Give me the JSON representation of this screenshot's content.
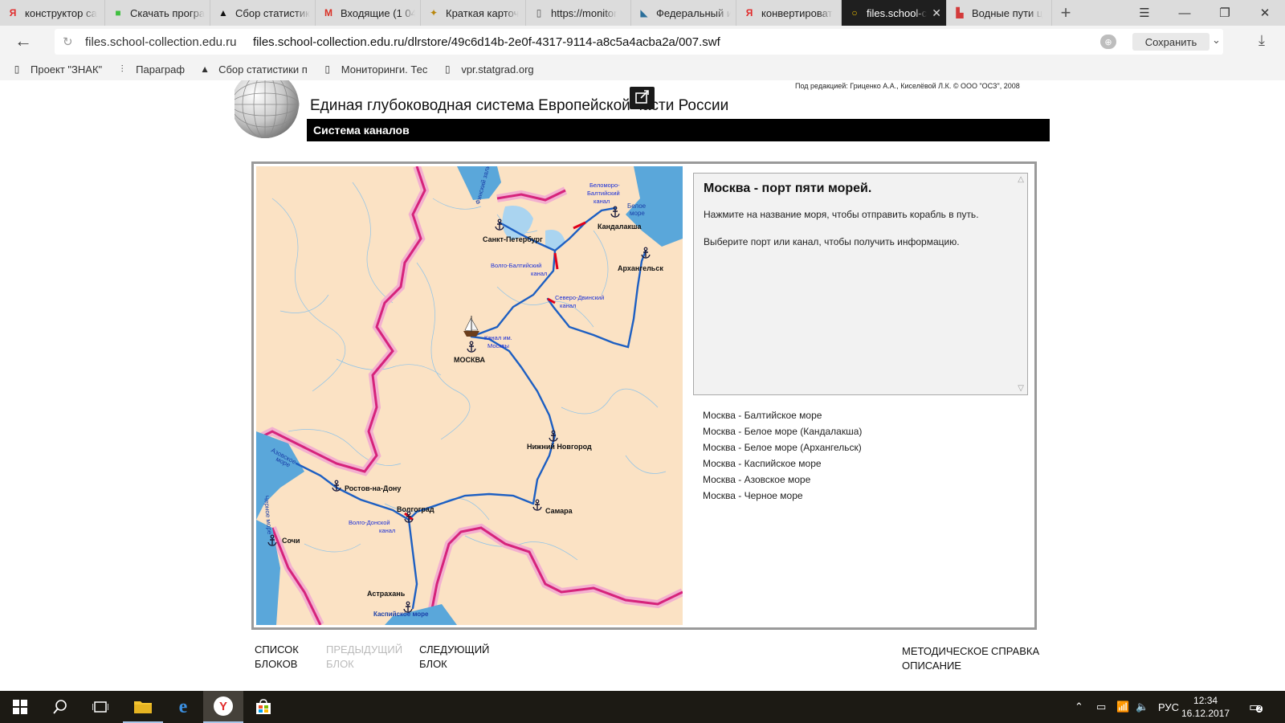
{
  "tabs": [
    {
      "title": "конструктор са",
      "icon": "yandex-icon",
      "color": "#e12b2b",
      "glyph": "Я"
    },
    {
      "title": "Скачать програ",
      "icon": "cube-icon",
      "color": "#3fbf3f",
      "glyph": "■"
    },
    {
      "title": "Сбор статистик",
      "icon": "horse-icon",
      "color": "#111111",
      "glyph": "▲"
    },
    {
      "title": "Входящие (1 04",
      "icon": "gmail-icon",
      "color": "#d93025",
      "glyph": "M"
    },
    {
      "title": "Краткая карточ",
      "icon": "emblem-icon",
      "color": "#b8860b",
      "glyph": "✦"
    },
    {
      "title": "https://monitor",
      "icon": "page-icon",
      "color": "#555555",
      "glyph": "▯"
    },
    {
      "title": "Федеральный и",
      "icon": "fipi-icon",
      "color": "#2b6f9a",
      "glyph": "◣"
    },
    {
      "title": "конвертироват",
      "icon": "yandex-icon",
      "color": "#e12b2b",
      "glyph": "Я"
    },
    {
      "title": "files.school-c",
      "icon": "loading-icon",
      "color": "#f0c000",
      "glyph": "○"
    },
    {
      "title": "Водные пути ц",
      "icon": "doc-red-icon",
      "color": "#d33a3a",
      "glyph": "▙"
    }
  ],
  "address": {
    "host": "files.school-collection.edu.ru",
    "url": "files.school-collection.edu.ru/dlrstore/49c6d14b-2e0f-4317-9114-a8c5a4acba2a/007.swf",
    "save_label": "Сохранить"
  },
  "bookmarks": [
    {
      "label": "Проект \"ЗНАК\"",
      "icon": "page-icon"
    },
    {
      "label": "Параграф",
      "icon": "paragraph-icon"
    },
    {
      "label": "Сбор статистики п",
      "icon": "horse-icon"
    },
    {
      "label": "Мониторинги. Тес",
      "icon": "page-icon"
    },
    {
      "label": "vpr.statgrad.org",
      "icon": "page-icon"
    }
  ],
  "page": {
    "credit": "Под редакцией: Гриценко А.А., Киселёвой Л.К. © ООО \"ОСЗ\", 2008",
    "title": "Единая глубоководная система Европейской части России",
    "subtitle": "Система каналов",
    "info_title": "Москва - порт пяти морей.",
    "info_line1": "Нажмите на название моря, чтобы отправить корабль в путь.",
    "info_line2": "Выберите порт или канал, чтобы получить информацию.",
    "routes": [
      "Москва - Балтийское море",
      "Москва - Белое море (Кандалакша)",
      "Москва - Белое море (Архангельск)",
      "Москва - Каспийское море",
      "Москва - Азовское море",
      "Москва - Черное море"
    ],
    "nav": {
      "list": [
        "СПИСОК",
        "БЛОКОВ"
      ],
      "prev": [
        "ПРЕДЫДУЩИЙ",
        "БЛОК"
      ],
      "next": [
        "СЛЕДУЮЩИЙ",
        "БЛОК"
      ],
      "method": [
        "МЕТОДИЧЕСКОЕ",
        "ОПИСАНИЕ"
      ],
      "help": "СПРАВКА"
    }
  },
  "map_labels": {
    "ports": [
      {
        "name": "Санкт-Петербург"
      },
      {
        "name": "Кандалакша"
      },
      {
        "name": "Архангельск"
      },
      {
        "name": "МОСКВА"
      },
      {
        "name": "Нижний Новгород"
      },
      {
        "name": "Самара"
      },
      {
        "name": "Волгоград"
      },
      {
        "name": "Ростов-на-Дону"
      },
      {
        "name": "Сочи"
      },
      {
        "name": "Астрахань"
      }
    ],
    "canals": [
      [
        "Беломоро-",
        "Балтийский",
        "канал"
      ],
      [
        "Волго-Балтийский",
        "канал"
      ],
      [
        "Северо-Двинский",
        "канал"
      ],
      [
        "Канал им.",
        "Москвы"
      ],
      [
        "Волго-Донской",
        "канал"
      ]
    ],
    "seas": {
      "white": [
        "Белое",
        "море"
      ],
      "finnish": "Финский залив",
      "azov": [
        "Азовское",
        "море"
      ],
      "black": "Черное море",
      "caspian": "Каспийское море"
    }
  },
  "taskbar": {
    "lang": "РУС",
    "time": "12:34",
    "date": "16.12.2017",
    "notifications": "2"
  },
  "colors": {
    "land": "#fbe2c4",
    "water": "#5aa7da",
    "waterway": "#1d5fc2",
    "border": "#d6237b",
    "canal_segment": "#e0001a"
  }
}
